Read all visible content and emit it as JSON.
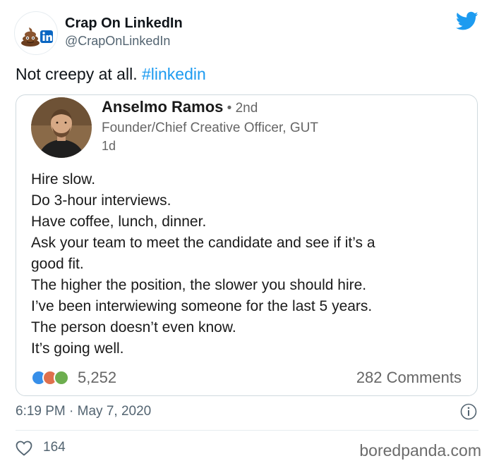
{
  "tweet": {
    "author_name": "Crap On LinkedIn",
    "author_handle": "@CrapOnLinkedIn",
    "text_plain": "Not creepy at all. ",
    "hashtag": "#linkedin",
    "timestamp": "6:19 PM · May 7, 2020",
    "like_count": "164",
    "accent_color": "#1d9bf0",
    "icons": [
      "poop-emoji-icon",
      "linkedin-logo-icon",
      "twitter-bird-icon",
      "info-icon",
      "heart-icon"
    ]
  },
  "linkedin_post": {
    "name": "Anselmo Ramos",
    "degree": " • 2nd",
    "title": "Founder/Chief Creative Officer, GUT",
    "time": "1d",
    "lines": [
      "Hire slow.",
      "Do 3-hour interviews.",
      "Have coffee, lunch, dinner.",
      "Ask your team to meet the candidate and see if it’s a",
      "good fit.",
      "The higher the position, the slower you should hire.",
      "I’ve been interwiewing someone for the last 5 years.",
      "The person doesn’t even know.",
      "It’s going well."
    ],
    "reaction_count": "5,252",
    "comments": "282 Comments",
    "reaction_icons": [
      "like-reaction-icon",
      "love-reaction-icon",
      "celebrate-reaction-icon"
    ]
  },
  "watermark": "boredpanda.com"
}
